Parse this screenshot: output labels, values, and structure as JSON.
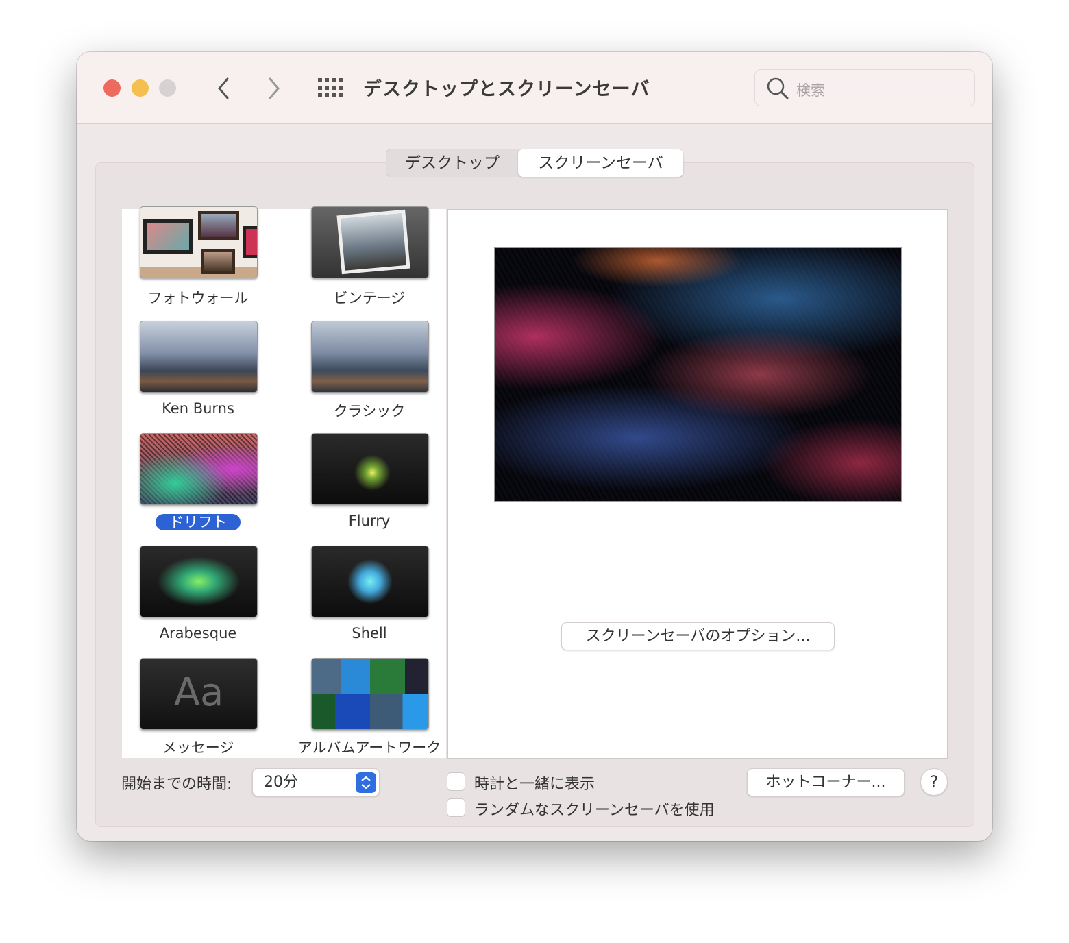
{
  "window": {
    "title": "デスクトップとスクリーンセーバ",
    "traffic_lights": {
      "close": "#ec6a5e",
      "minimize": "#f4bf4f",
      "zoom": "#d6d2d2"
    }
  },
  "toolbar": {
    "back_icon": "chevron-left-icon",
    "forward_icon": "chevron-right-icon",
    "grid_icon": "show-all-grid-icon",
    "search_placeholder": "検索"
  },
  "tabs": [
    {
      "label": "デスクトップ",
      "selected": false
    },
    {
      "label": "スクリーンセーバ",
      "selected": true
    }
  ],
  "screensavers": [
    {
      "label": "フォトウォール",
      "selected": false
    },
    {
      "label": "ビンテージ",
      "selected": false
    },
    {
      "label": "Ken Burns",
      "selected": false
    },
    {
      "label": "クラシック",
      "selected": false
    },
    {
      "label": "ドリフト",
      "selected": true
    },
    {
      "label": "Flurry",
      "selected": false
    },
    {
      "label": "Arabesque",
      "selected": false
    },
    {
      "label": "Shell",
      "selected": false
    },
    {
      "label": "メッセージ",
      "selected": false,
      "thumb_text": "Aa"
    },
    {
      "label": "アルバムアートワーク",
      "selected": false
    }
  ],
  "preview": {
    "options_button": "スクリーンセーバのオプション..."
  },
  "bottom": {
    "start_after_label": "開始までの時間:",
    "start_after_value": "20分",
    "show_clock_label": "時計と一緒に表示",
    "show_clock_checked": false,
    "random_label": "ランダムなスクリーンセーバを使用",
    "random_checked": false,
    "hot_corners_button": "ホットコーナー...",
    "help_button": "?"
  },
  "colors": {
    "accent": "#2c62d3"
  }
}
